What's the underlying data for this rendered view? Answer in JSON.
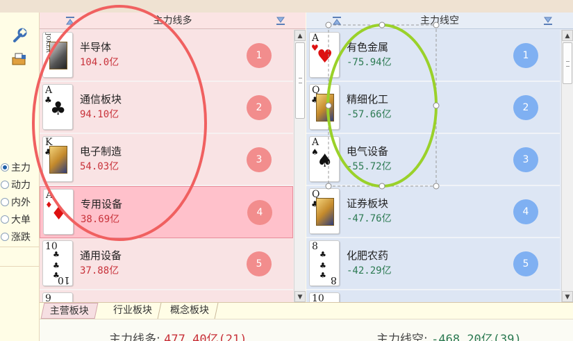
{
  "toolbar": {
    "tools": [
      "wrench-icon",
      "print-icon"
    ]
  },
  "modes": {
    "options": [
      "主力",
      "动力",
      "内外",
      "大单",
      "涨跌"
    ],
    "selected": "主力"
  },
  "long_panel": {
    "title": "主力线多",
    "rows": [
      {
        "rank": "1",
        "name": "半导体",
        "value": "104.0亿",
        "card": {
          "label": "JOKER",
          "color": "#111111"
        }
      },
      {
        "rank": "2",
        "name": "通信板块",
        "value": "94.10亿",
        "card": {
          "label": "A",
          "suit": "♣",
          "color": "#111111"
        }
      },
      {
        "rank": "3",
        "name": "电子制造",
        "value": "54.03亿",
        "card": {
          "label": "K",
          "suit": "♣",
          "color": "#111111"
        }
      },
      {
        "rank": "4",
        "name": "专用设备",
        "value": "38.69亿",
        "card": {
          "label": "A",
          "suit": "♦",
          "color": "#d11111"
        },
        "selected": true
      },
      {
        "rank": "5",
        "name": "通用设备",
        "value": "37.88亿",
        "card": {
          "label": "10",
          "suit": "♣",
          "color": "#111111"
        }
      }
    ],
    "partial_card": "9"
  },
  "short_panel": {
    "title": "主力线空",
    "rows": [
      {
        "rank": "1",
        "name": "有色金属",
        "value": "-75.94亿",
        "card": {
          "label": "A",
          "suit": "♥",
          "color": "#d11111"
        }
      },
      {
        "rank": "2",
        "name": "精细化工",
        "value": "-57.66亿",
        "card": {
          "label": "Q",
          "suit": "♣",
          "color": "#111111"
        }
      },
      {
        "rank": "3",
        "name": "电气设备",
        "value": "-55.72亿",
        "card": {
          "label": "A",
          "suit": "♠",
          "color": "#111111"
        }
      },
      {
        "rank": "4",
        "name": "证券板块",
        "value": "-47.76亿",
        "card": {
          "label": "Q",
          "suit": "♣",
          "color": "#111111"
        }
      },
      {
        "rank": "5",
        "name": "化肥农药",
        "value": "-42.29亿",
        "card": {
          "label": "8",
          "suit": "♣",
          "color": "#111111"
        }
      }
    ],
    "partial_card": "10"
  },
  "tabs": [
    "主营板块",
    "行业板块",
    "概念板块"
  ],
  "active_tab": "主营板块",
  "footer": {
    "long_label": "主力线多: ",
    "long_value": "477.40亿(21)",
    "short_label": "主力线空: ",
    "short_value": "-468.20亿(39)"
  },
  "colors": {
    "annotation_red": "#f06060",
    "annotation_green": "#9ad12a",
    "long_value": "#c8323a",
    "short_value": "#2c7a52",
    "long_badge": "#f28d8d",
    "short_badge": "#7fb0f2"
  }
}
